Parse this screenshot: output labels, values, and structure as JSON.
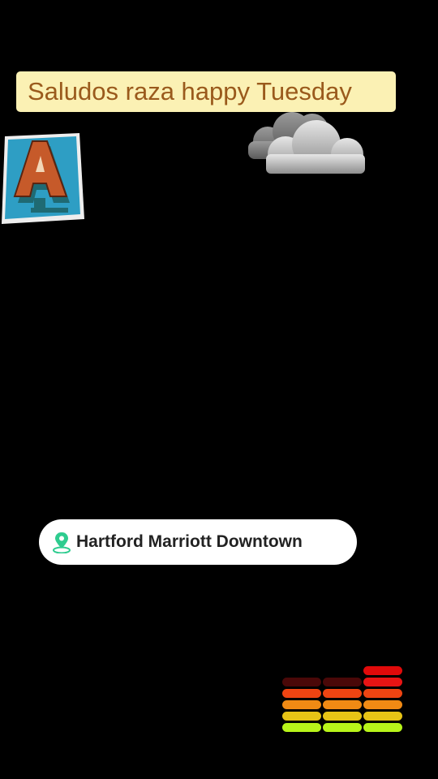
{
  "caption": {
    "text": "Saludos raza happy Tuesday"
  },
  "stickers": {
    "letter": {
      "glyph": "A",
      "icon": "letter-a-sticker-icon"
    },
    "weather": {
      "icon": "cloud-icon"
    }
  },
  "location": {
    "icon": "location-pin-icon",
    "name": "Hartford Marriott Downtown"
  },
  "equalizer": {
    "icon": "audio-equalizer-icon",
    "levels": [
      4,
      4,
      6
    ]
  },
  "colors": {
    "background": "#000000",
    "caption_bg": "#fbf1b4",
    "caption_text": "#9a5a1c",
    "pin": "#2ecc8f"
  }
}
